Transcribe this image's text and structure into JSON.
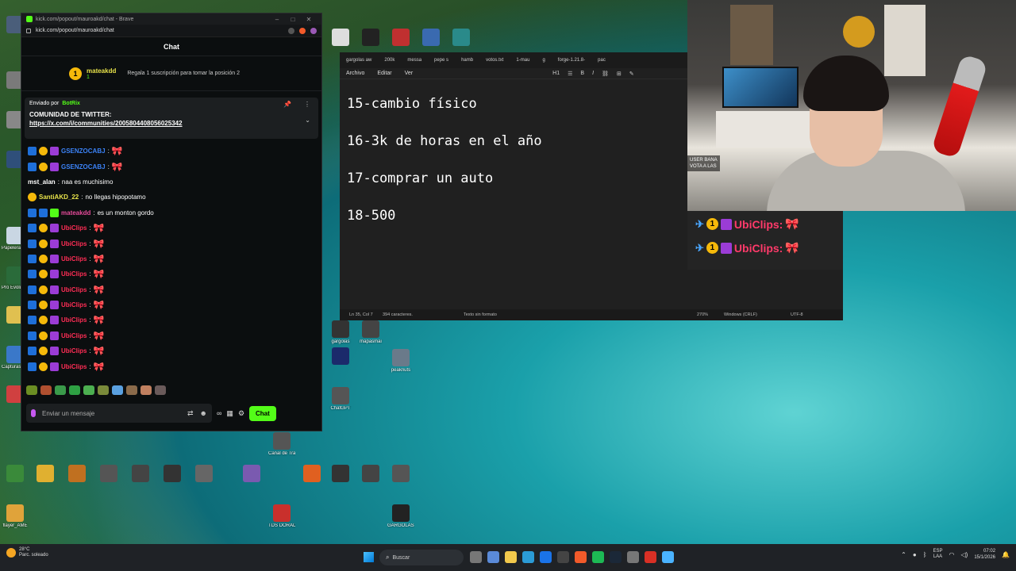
{
  "browser": {
    "tab_title": "kick.com/popout/mauroakd/chat - Brave",
    "address": "kick.com/popout/mauroakd/chat"
  },
  "chat": {
    "header": "Chat",
    "top_gifter": {
      "username": "mateakdd",
      "badge_value": "1",
      "gift_prompt": "Regala 1 suscripción para tomar la posición 2"
    },
    "pinned": {
      "sent_by_label": "Enviado por",
      "sender": "BotRix",
      "title": "COMUNIDAD DE TWITTER:",
      "link": "https://x.com/i/communities/2005804408056025342"
    },
    "messages": [
      {
        "user": "GSENZOCABJ",
        "color": "#3b82f6",
        "text": "",
        "emote": "🎀"
      },
      {
        "user": "GSENZOCABJ",
        "color": "#3b82f6",
        "text": "",
        "emote": "🎀"
      },
      {
        "user": "mst_alan",
        "color": "#ffffff",
        "text": "naa es muchisimo",
        "emote": ""
      },
      {
        "user": "SantiAKD_22",
        "color": "#e8e34a",
        "text": "no llegas hipopotamo",
        "emote": ""
      },
      {
        "user": "mateakdd",
        "color": "#e64b9a",
        "text": "es un monton gordo",
        "emote": ""
      },
      {
        "user": "UbiClips",
        "color": "#ff2d55",
        "text": "",
        "emote": "🎀"
      },
      {
        "user": "UbiClips",
        "color": "#ff2d55",
        "text": "",
        "emote": "🎀"
      },
      {
        "user": "UbiClips",
        "color": "#ff2d55",
        "text": "",
        "emote": "🎀"
      },
      {
        "user": "UbiClips",
        "color": "#ff2d55",
        "text": "",
        "emote": "🎀"
      },
      {
        "user": "UbiClips",
        "color": "#ff2d55",
        "text": "",
        "emote": "🎀"
      },
      {
        "user": "UbiClips",
        "color": "#ff2d55",
        "text": "",
        "emote": "🎀"
      },
      {
        "user": "UbiClips",
        "color": "#ff2d55",
        "text": "",
        "emote": "🎀"
      },
      {
        "user": "UbiClips",
        "color": "#ff2d55",
        "text": "",
        "emote": "🎀"
      },
      {
        "user": "UbiClips",
        "color": "#ff2d55",
        "text": "",
        "emote": "🎀"
      },
      {
        "user": "UbiClips",
        "color": "#ff2d55",
        "text": "",
        "emote": "🎀"
      }
    ],
    "input_placeholder": "Enviar un mensaje",
    "send_label": "Chat"
  },
  "notepad": {
    "tabs": [
      "gargolas aw",
      "200k",
      "messa",
      "pepe s",
      "hamb",
      "votos.txt",
      "1-mau",
      "g",
      "forge-1.21.8-",
      "pac"
    ],
    "menu": [
      "Archivo",
      "Editar",
      "Ver"
    ],
    "heading_label": "H1",
    "lines": [
      "15-cambio físico",
      "16-3k de horas en el año",
      "17-comprar un auto",
      "18-500"
    ],
    "status": {
      "position": "Ln 35, Col 7",
      "chars": "394 caracteres.",
      "format": "Texto sin formato",
      "zoom": "270%",
      "eol": "Windows (CRLF)",
      "encoding": "UTF-8"
    }
  },
  "webcam_overlay": {
    "line1": "USER BANA",
    "line2": "VOTA A LAS"
  },
  "overlay_chat": [
    {
      "user": "UbiClips:",
      "emote": "🎀"
    },
    {
      "user": "UbiClips:",
      "emote": "🎀"
    }
  ],
  "taskbar": {
    "temperature": "28°C",
    "weather": "Parc. soleado",
    "search_label": "Buscar",
    "lang_top": "ESP",
    "lang_bottom": "LAA",
    "time": "07:02",
    "date": "15/1/2026"
  },
  "desktop_icons": [
    {
      "label": "Papelera de reciclaje"
    },
    {
      "label": "Pro Evolution Soccer"
    },
    {
      "label": "Capturas de pantalla"
    },
    {
      "label": "flayer_AME"
    },
    {
      "label": "GARGOLAS AWARDS"
    },
    {
      "label": "gargolas"
    },
    {
      "label": "mapasmai"
    },
    {
      "label": "Canal de Transicion"
    },
    {
      "label": "ChatGPT"
    },
    {
      "label": "peaknuts"
    },
    {
      "label": "TDS DORADO"
    }
  ]
}
